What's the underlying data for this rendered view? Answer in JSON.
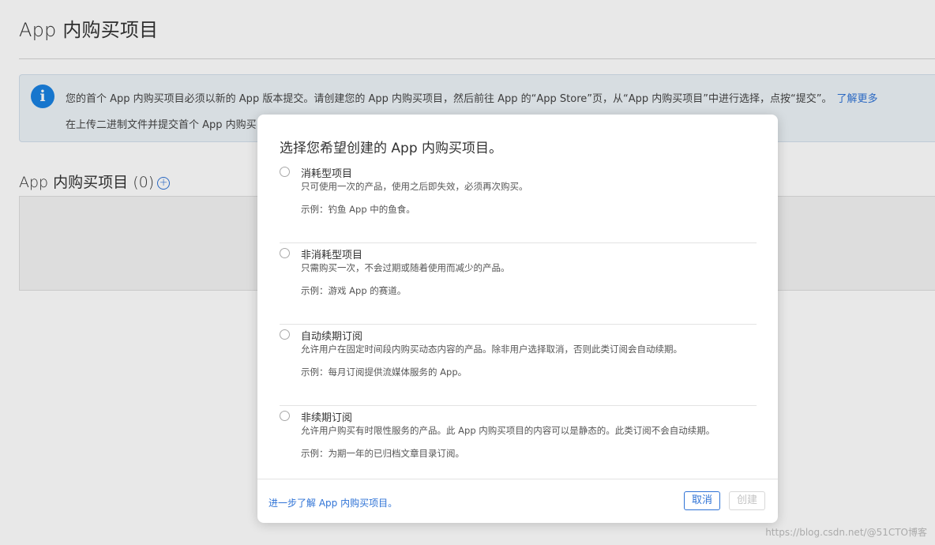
{
  "page": {
    "title": "App 内购买项目"
  },
  "banner": {
    "icon": "info-icon",
    "icon_glyph": "i",
    "text_line1": "您的首个 App 内购买项目必须以新的 App 版本提交。请创建您的 App 内购买项目，然后前往 App 的“App Store”页，从“App 内购买项目”中进行选择，点按“提交”。",
    "learn_more": "了解更多",
    "text_line2": "在上传二进制文件并提交首个 App 内购买"
  },
  "iap_section": {
    "heading": "App 内购买项目 (0)",
    "add_icon_glyph": "+"
  },
  "modal": {
    "title": "选择您希望创建的 App 内购买项目。",
    "options": [
      {
        "name": "消耗型项目",
        "description": "只可使用一次的产品，使用之后即失效，必须再次购买。",
        "example": "示例：钓鱼 App 中的鱼食。"
      },
      {
        "name": "非消耗型项目",
        "description": "只需购买一次，不会过期或随着使用而减少的产品。",
        "example": "示例：游戏 App 的赛道。"
      },
      {
        "name": "自动续期订阅",
        "description": "允许用户在固定时间段内购买动态内容的产品。除非用户选择取消，否则此类订阅会自动续期。",
        "example": "示例：每月订阅提供流媒体服务的 App。"
      },
      {
        "name": "非续期订阅",
        "description": "允许用户购买有时限性服务的产品。此 App 内购买项目的内容可以是静态的。此类订阅不会自动续期。",
        "example": "示例：为期一年的已归档文章目录订阅。"
      }
    ],
    "footer_link": "进一步了解 App 内购买项目。",
    "cancel_label": "取消",
    "create_label": "创建"
  },
  "watermark": "https://blog.csdn.net/@51CTO博客",
  "colors": {
    "accent": "#2f73d6",
    "info_icon": "#1a82e2",
    "banner_bg": "#edf3f8"
  }
}
